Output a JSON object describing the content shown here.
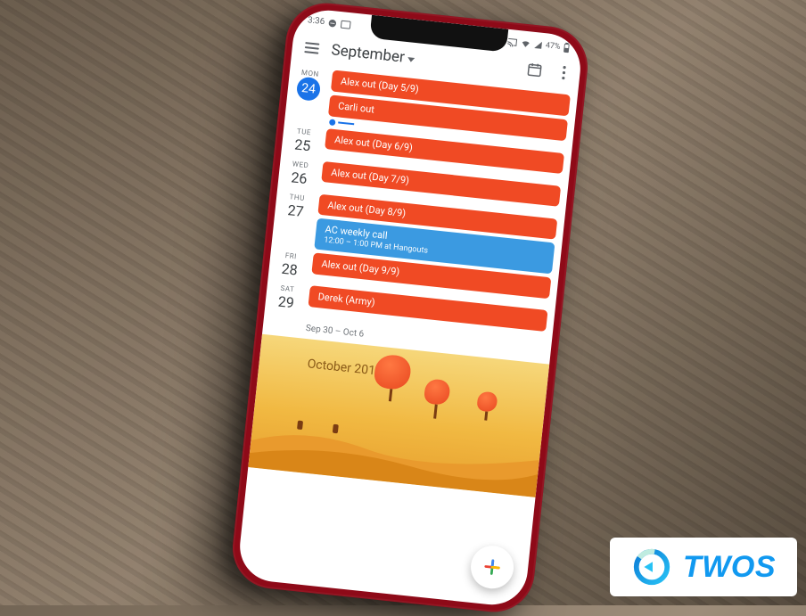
{
  "status_bar": {
    "time": "3:36",
    "dnd_icon": "dnd-icon",
    "camera_icon": "camera-icon",
    "cast_icon": "cast-icon",
    "wifi_icon": "wifi-icon",
    "cell_icon": "signal-icon",
    "battery_text": "47%",
    "battery_icon": "battery-icon"
  },
  "header": {
    "month_label": "September",
    "today_icon": "calendar-today-icon",
    "overflow_icon": "more-vert-icon"
  },
  "days": [
    {
      "weekday": "MON",
      "number": "24",
      "selected": true,
      "events": [
        {
          "title": "Alex out (Day 5/9)",
          "color": "orange"
        },
        {
          "title": "Carli out",
          "color": "orange"
        }
      ],
      "show_now_marker": true
    },
    {
      "weekday": "TUE",
      "number": "25",
      "selected": false,
      "events": [
        {
          "title": "Alex out (Day 6/9)",
          "color": "orange"
        }
      ]
    },
    {
      "weekday": "WED",
      "number": "26",
      "selected": false,
      "events": [
        {
          "title": "Alex out (Day 7/9)",
          "color": "orange"
        }
      ]
    },
    {
      "weekday": "THU",
      "number": "27",
      "selected": false,
      "events": [
        {
          "title": "Alex out (Day 8/9)",
          "color": "orange"
        },
        {
          "title": "AC weekly call",
          "subtitle": "12:00 – 1:00 PM at Hangouts",
          "color": "blue"
        }
      ]
    },
    {
      "weekday": "FRI",
      "number": "28",
      "selected": false,
      "events": [
        {
          "title": "Alex out (Day 9/9)",
          "color": "orange"
        }
      ]
    },
    {
      "weekday": "SAT",
      "number": "29",
      "selected": false,
      "events": [
        {
          "title": "Derek (Army)",
          "color": "orange"
        }
      ]
    }
  ],
  "week_divider": "Sep 30 – Oct 6",
  "month_banner": {
    "label": "October 2018"
  },
  "fab": {
    "icon": "plus-icon"
  },
  "watermark": {
    "text": "TWOS"
  },
  "colors": {
    "event_orange": "#f04a24",
    "event_blue": "#3b9ae1",
    "accent_blue": "#1a73e8",
    "brand_blue": "#1199f0"
  }
}
